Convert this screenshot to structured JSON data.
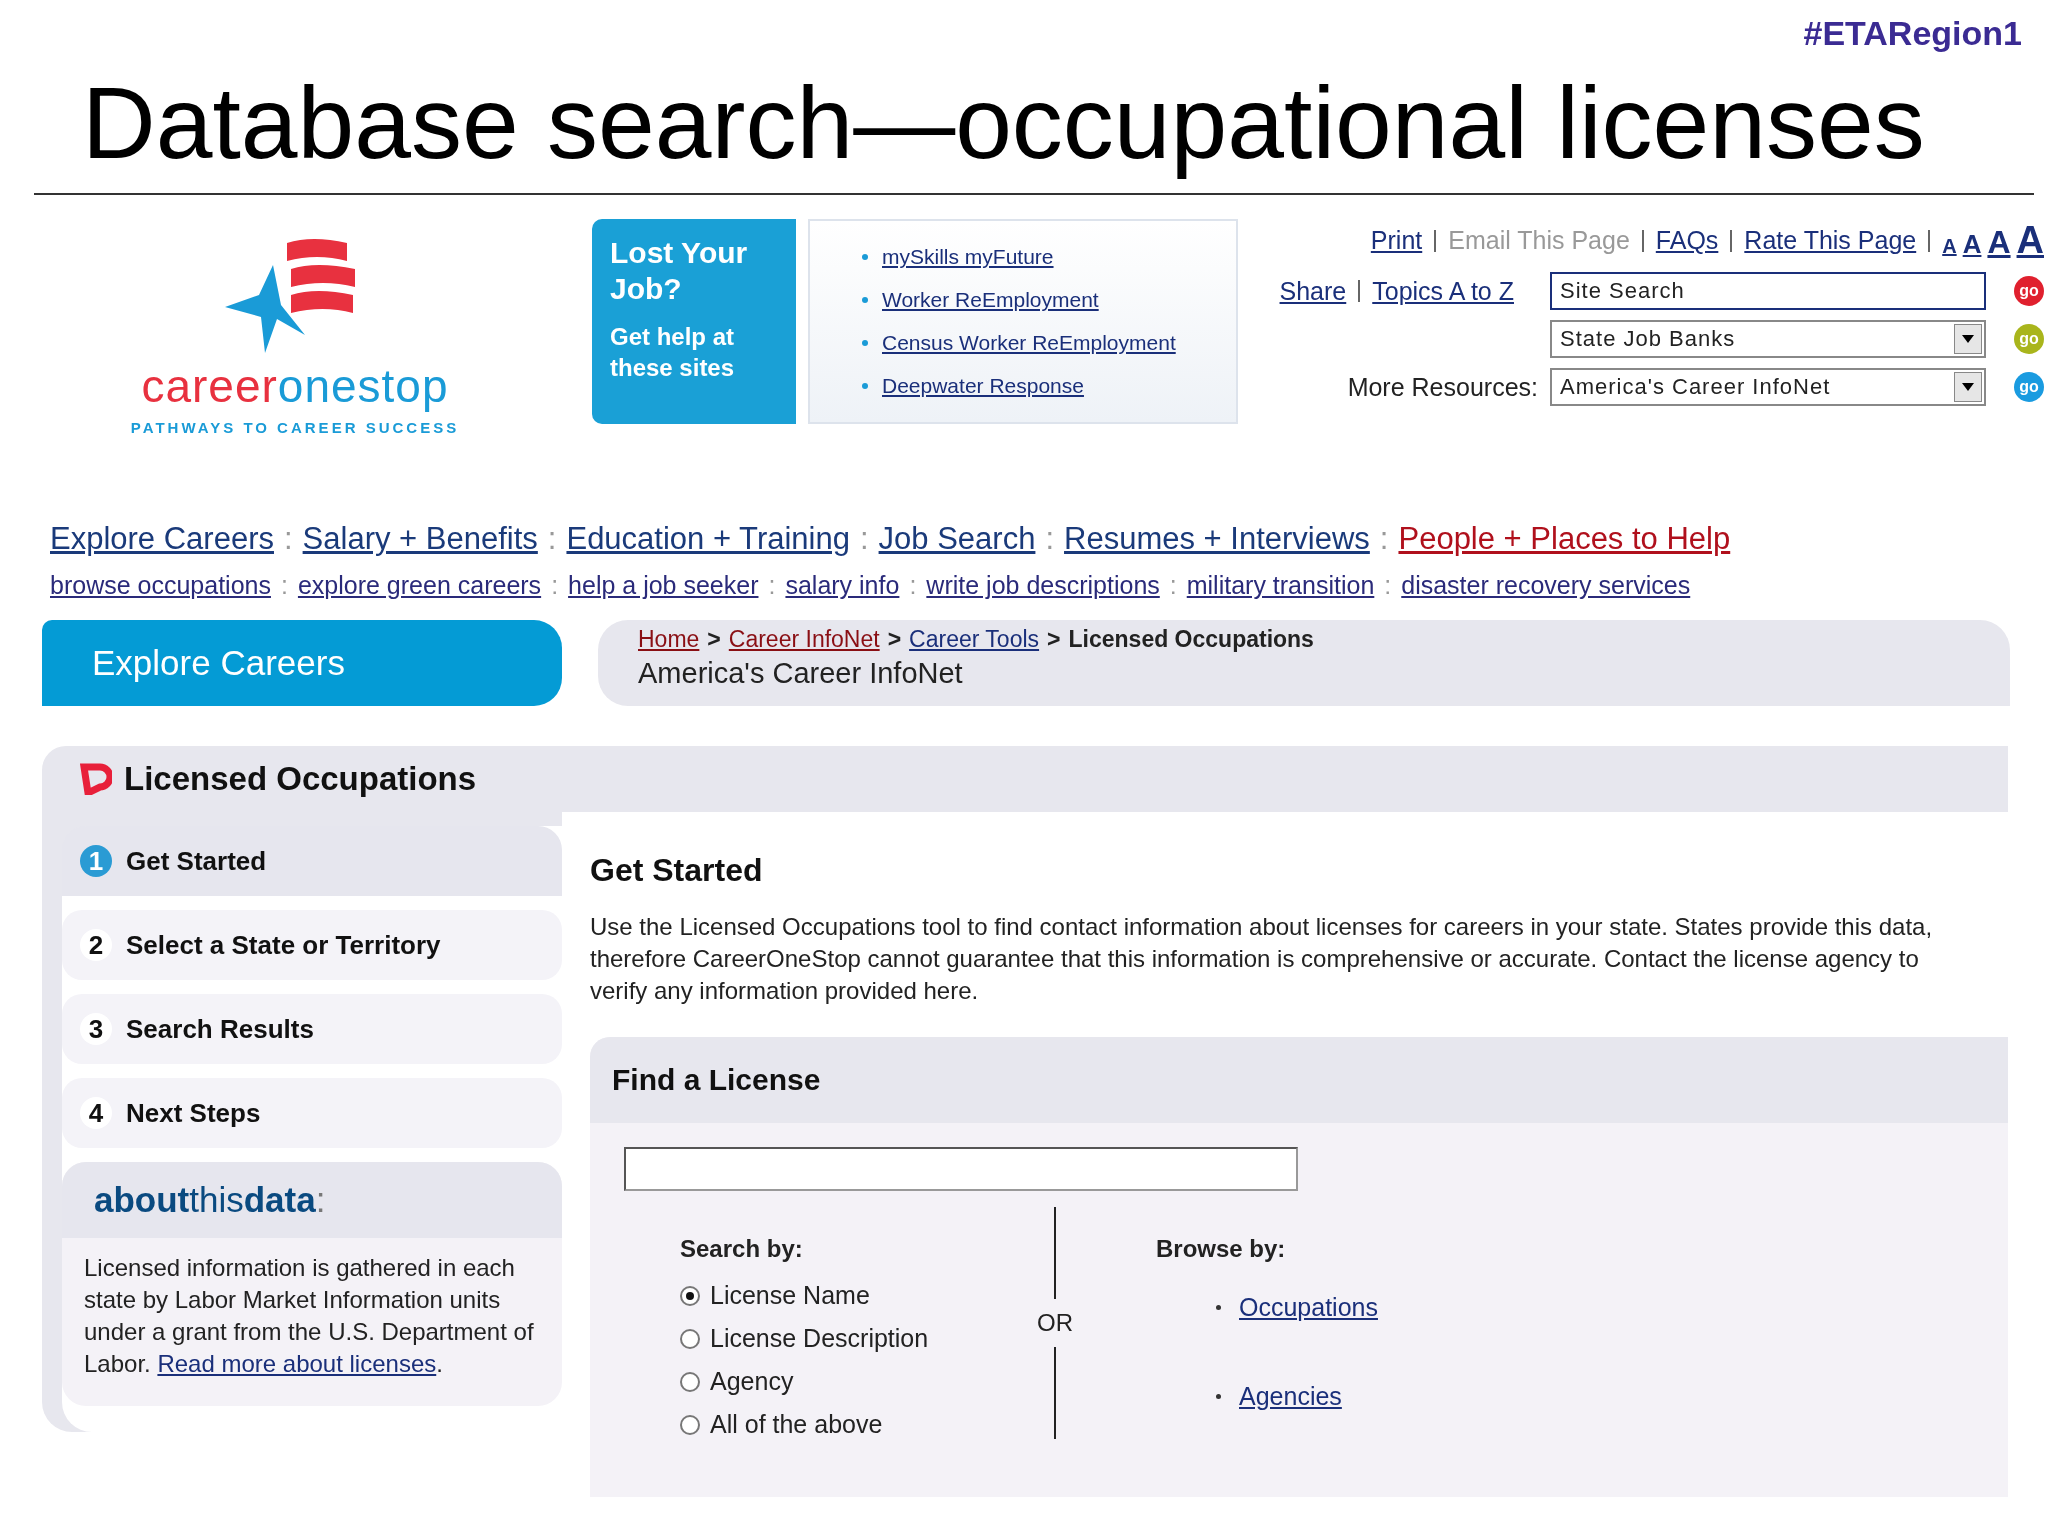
{
  "slide": {
    "hashtag": "#ETARegion1",
    "title": "Database search—occupational licenses"
  },
  "logo": {
    "name_parts": [
      "career",
      "onestop"
    ],
    "tagline": "PATHWAYS TO CAREER SUCCESS"
  },
  "promo": {
    "heading": "Lost Your Job?",
    "subheading": "Get help at these sites",
    "links": [
      "mySkills myFuture",
      "Worker ReEmployment",
      "Census Worker ReEmployment",
      "Deepwater Response"
    ]
  },
  "utility_links": [
    {
      "label": "Print",
      "disabled": false
    },
    {
      "label": "Email This Page",
      "disabled": true
    },
    {
      "label": "FAQs",
      "disabled": false
    },
    {
      "label": "Rate This Page",
      "disabled": false
    }
  ],
  "text_sizes": [
    "A",
    "A",
    "A",
    "A"
  ],
  "utility_links_2": [
    "Share",
    "Topics A to Z"
  ],
  "site_search": {
    "value": "Site Search",
    "go": {
      "label": "go",
      "color": "#e0202e"
    }
  },
  "job_banks": {
    "value": "State Job Banks",
    "go": {
      "label": "go",
      "color": "#a9b51c"
    }
  },
  "more_resources": {
    "label": "More Resources:",
    "value": "America's Career InfoNet",
    "go": {
      "label": "go",
      "color": "#1a9be0"
    }
  },
  "main_nav": [
    {
      "label": "Explore Careers",
      "highlight": false
    },
    {
      "label": "Salary + Benefits",
      "highlight": false
    },
    {
      "label": "Education + Training",
      "highlight": false
    },
    {
      "label": "Job Search",
      "highlight": false
    },
    {
      "label": "Resumes + Interviews",
      "highlight": false
    },
    {
      "label": "People + Places to Help",
      "highlight": true
    }
  ],
  "nav_separator": ":",
  "sub_nav": [
    "browse occupations",
    "explore green careers",
    "help a job seeker",
    "salary info",
    "write job descriptions",
    "military transition",
    "disaster recovery services"
  ],
  "section_tab": "Explore Careers",
  "breadcrumb": {
    "separator": ">",
    "links": [
      "Home",
      "Career InfoNet",
      "Career Tools"
    ],
    "current": "Licensed Occupations",
    "site": "America's Career InfoNet"
  },
  "tool_title": "Licensed Occupations",
  "steps": [
    {
      "number": "1",
      "label": "Get Started",
      "selected": true
    },
    {
      "number": "2",
      "label": "Select a State or Territory",
      "selected": false
    },
    {
      "number": "3",
      "label": "Search Results",
      "selected": false
    },
    {
      "number": "4",
      "label": "Next Steps",
      "selected": false
    }
  ],
  "about": {
    "heading_parts": [
      "about",
      "this",
      "data",
      ":"
    ],
    "text": "Licensed information is gathered in each state by Labor Market Information units under a grant from the U.S. Department of Labor.",
    "link": "Read more about licenses",
    "after": "."
  },
  "content": {
    "heading": "Get Started",
    "intro": "Use the Licensed Occupations tool to find contact information about licenses for careers in your state. States provide this data, therefore CareerOneStop cannot guarantee that this information is comprehensive or accurate. Contact the license agency to verify any information provided here."
  },
  "find_license": {
    "heading": "Find a License",
    "search_by_label": "Search by:",
    "options": [
      {
        "label": "License Name",
        "selected": true
      },
      {
        "label": "License Description",
        "selected": false
      },
      {
        "label": "Agency",
        "selected": false
      },
      {
        "label": "All of the above",
        "selected": false
      }
    ],
    "or": "OR",
    "browse_by_label": "Browse by:",
    "browse_links": [
      "Occupations",
      "Agencies"
    ]
  }
}
